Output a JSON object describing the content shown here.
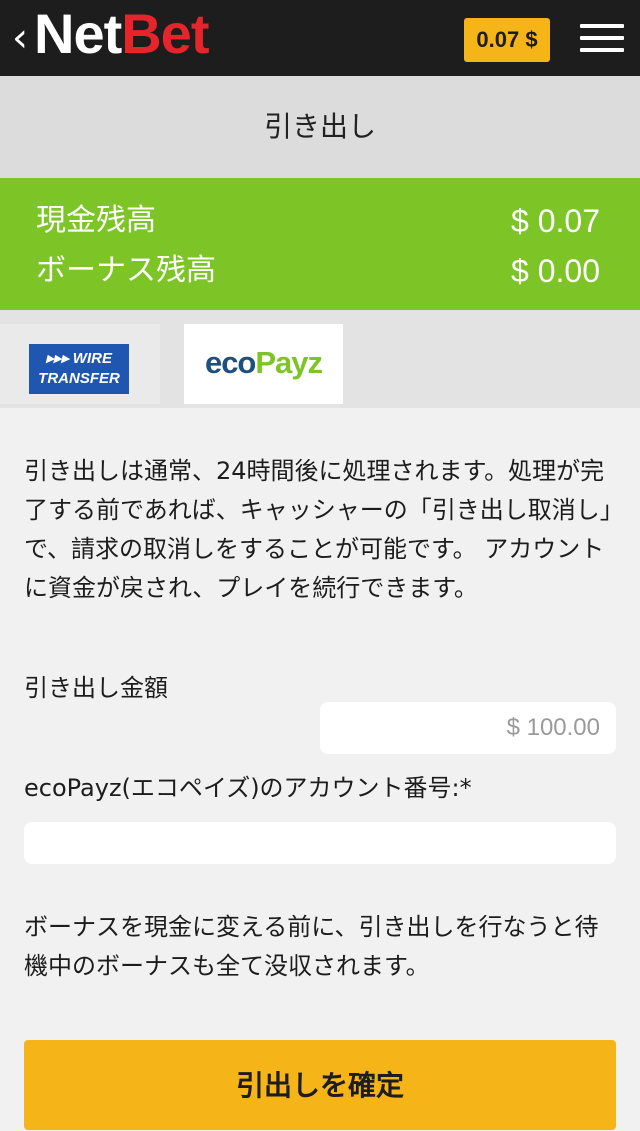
{
  "header": {
    "back_icon": "chevron-left-icon",
    "logo_part1": "Net",
    "logo_part2": "Bet",
    "balance_badge": "0.07 $",
    "menu_icon": "hamburger-menu-icon"
  },
  "page": {
    "title": "引き出し"
  },
  "balances": {
    "cash_label": "現金残高",
    "cash_value": "$ 0.07",
    "bonus_label": "ボーナス残高",
    "bonus_value": "$ 0.00"
  },
  "payment_methods": {
    "wire_line1": "▸▸▸ WIRE",
    "wire_line2": "TRANSFER",
    "ecopayz_part1": "eco",
    "ecopayz_part2": "Payz"
  },
  "form": {
    "info_text": "引き出しは通常、24時間後に処理されます。処理が完了する前であれば、キャッシャーの「引き出し取消し」で、請求の取消しをすることが可能です。 アカウントに資金が戻され、プレイを続行できます。",
    "amount_label": "引き出し金額",
    "amount_placeholder": "$ 100.00",
    "account_label": "ecoPayz(エコペイズ)のアカウント番号:*",
    "account_value": "",
    "notice_text": "ボーナスを現金に変える前に、引き出しを行なうと待機中のボーナスも全て没収されます。",
    "confirm_button": "引出しを確定"
  },
  "colors": {
    "accent_yellow": "#f5b418",
    "balance_green": "#7dc427",
    "header_dark": "#1d1d1d",
    "logo_red": "#e5242b"
  }
}
